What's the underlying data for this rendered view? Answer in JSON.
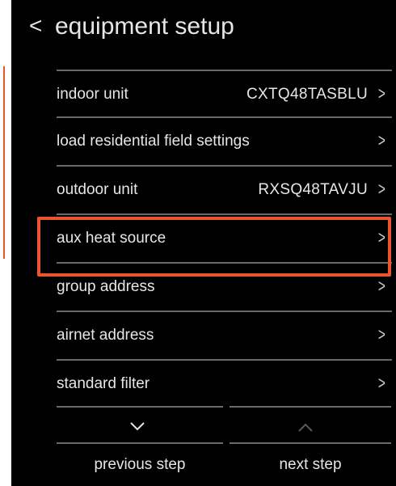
{
  "header": {
    "back_glyph": "<",
    "title": "equipment setup"
  },
  "items": [
    {
      "label": "indoor unit",
      "value": "CXTQ48TASBLU"
    },
    {
      "label": "load residential field settings",
      "value": ""
    },
    {
      "label": "outdoor unit",
      "value": "RXSQ48TAVJU"
    },
    {
      "label": "aux heat source",
      "value": ""
    },
    {
      "label": "group address",
      "value": ""
    },
    {
      "label": "airnet address",
      "value": ""
    },
    {
      "label": "standard filter",
      "value": ""
    }
  ],
  "chevron_glyph": ">",
  "footer": {
    "previous_label": "previous step",
    "next_label": "next step"
  },
  "colors": {
    "background": "#000000",
    "text": "#e6e6e6",
    "highlight": "#e8552f",
    "divider": "#6a6a6a"
  },
  "icons": {
    "back": "back-chevron-icon",
    "row": "chevron-right-icon",
    "down": "chevron-down-icon",
    "up": "chevron-up-icon"
  }
}
